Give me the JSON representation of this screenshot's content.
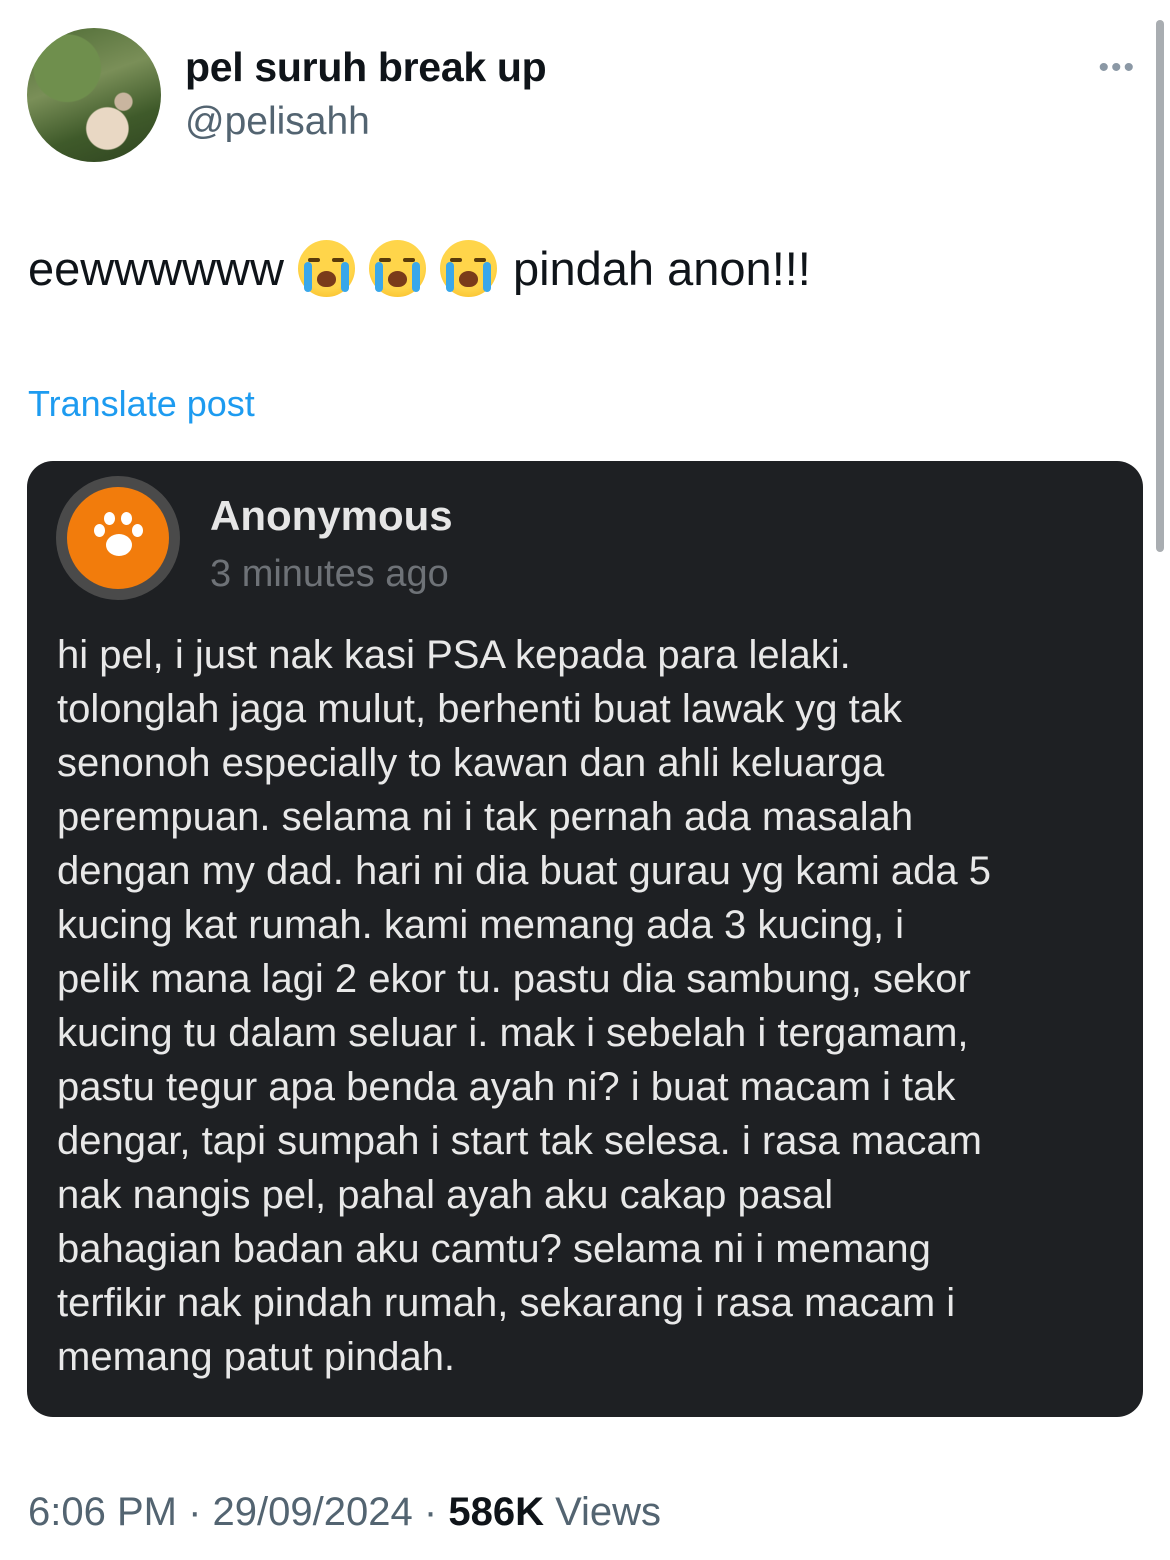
{
  "post": {
    "display_name": "pel suruh break up",
    "handle": "@pelisahh",
    "more_icon": "more-horizontal-icon",
    "text_before": "eewwwwww",
    "emoji": "loudly-crying-face",
    "text_after": "pindah anon!!!",
    "translate_label": "Translate post"
  },
  "quoted": {
    "name": "Anonymous",
    "time": "3 minutes ago",
    "avatar_icon": "paw-icon",
    "avatar_color": "#f27c0c",
    "lines": [
      "hi pel, i just nak kasi PSA kepada para lelaki.",
      "tolonglah jaga mulut, berhenti buat lawak yg tak",
      "senonoh especially to kawan dan ahli keluarga",
      "perempuan. selama ni i tak pernah ada masalah",
      "dengan my dad. hari ni dia buat gurau yg kami ada 5",
      "kucing kat rumah. kami memang ada 3 kucing, i",
      "pelik mana lagi 2 ekor tu. pastu dia sambung, sekor",
      "kucing tu dalam seluar i. mak i sebelah i tergamam,",
      "pastu tegur apa benda ayah ni? i buat macam i tak",
      "dengar, tapi sumpah i start tak selesa. i rasa macam",
      "nak nangis pel, pahal ayah aku cakap pasal",
      "bahagian badan aku camtu? selama ni i memang",
      "terfikir nak pindah rumah, sekarang i rasa macam i",
      "memang patut pindah."
    ]
  },
  "meta": {
    "time": "6:06 PM",
    "sep": "·",
    "date": "29/09/2024",
    "views_count": "586K",
    "views_label": "Views"
  }
}
